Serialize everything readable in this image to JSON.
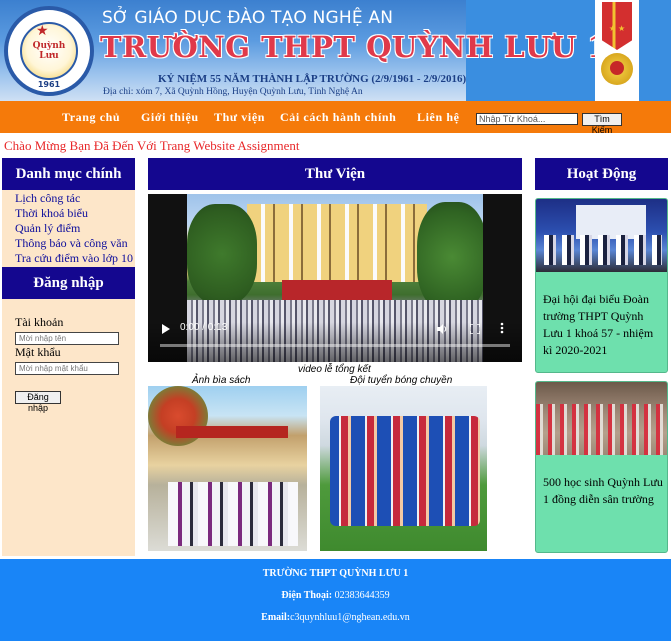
{
  "header": {
    "department": "SỞ GIÁO DỤC ĐÀO TẠO NGHỆ AN",
    "school_name": "TRƯỜNG THPT QUỲNH LƯU 1",
    "anniversary": "KỶ NIỆM 55 NĂM THÀNH LẬP TRƯỜNG (2/9/1961 - 2/9/2016)",
    "address": "Địa chỉ: xóm 7, Xã Quỳnh Hồng,  Huyện Quỳnh Lưu, Tỉnh Nghệ An",
    "logo": {
      "text": "Quỳnh Lưu",
      "year": "1961",
      "icon": "school-logo-icon"
    },
    "medal_icon": "medal-icon"
  },
  "nav": {
    "items": [
      "Trang chủ",
      "Giới thiệu",
      "Thư viện",
      "Cải cách hành chính",
      "Liên hệ"
    ],
    "search_placeholder": "Nhập Từ Khoá...",
    "search_button": "Tìm Kiếm"
  },
  "welcome": "Chào Mừng Bạn Đã Đến Với Trang Website Assignment",
  "left": {
    "menu_title": "Danh mục chính",
    "menu_items": [
      "Lịch công tác",
      "Thời khoá biểu",
      "Quản lý điểm",
      "Thông báo và công văn",
      "Tra cứu điểm vào lớp 10"
    ],
    "login_title": "Đăng nhập",
    "username_label": "Tài khoản",
    "username_placeholder": "Mời nhập tên",
    "password_label": "Mật khẩu",
    "password_placeholder": "Mời nhập mật khẩu",
    "login_button": "Đăng nhập"
  },
  "library": {
    "title": "Thư Viện",
    "video": {
      "time": "0:00 / 0:13",
      "progress": 0,
      "caption": "video lễ tổng kết"
    },
    "photos": [
      {
        "caption": "Ảnh bìa sách"
      },
      {
        "caption": "Đội tuyển bóng chuyền"
      }
    ]
  },
  "activities": {
    "title": "Hoạt Động",
    "items": [
      "Đại hội đại biểu Đoàn trường THPT Quỳnh Lưu 1 khoá 57 - nhiệm kì 2020-2021",
      "500 học sinh Quỳnh Lưu 1 đồng diễn sân trường"
    ]
  },
  "footer": {
    "school": "TRƯỜNG THPT QUỲNH LƯU 1",
    "phone_label": "Điện Thoại:",
    "phone": "02383644359",
    "email_label": "Email:",
    "email": "c3quynhluu1@nghean.edu.vn"
  },
  "colors": {
    "nav_bg": "#f57a0a",
    "panel_title_bg": "#14078f",
    "left_bg": "#fde6c9",
    "activity_bg": "#6ee0ad",
    "footer_bg": "#1985f7",
    "welcome_text": "#e8282a"
  }
}
